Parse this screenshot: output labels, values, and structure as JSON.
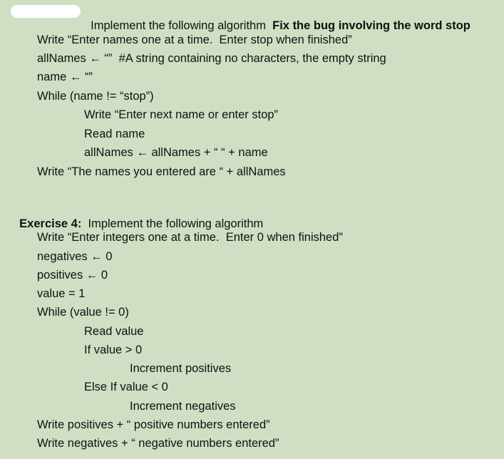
{
  "exercise3": {
    "heading_prefix": "Implement the following algorithm",
    "heading_bold": "Fix the bug involving the word stop",
    "lines": [
      "Write “Enter names one at a time.  Enter stop when finished”",
      "allNames ← “”  #A string containing no characters, the empty string",
      "name ← “”",
      "While (name != “stop”)",
      "Write “Enter next name or enter stop”",
      "Read name",
      "allNames ← allNames + “ “ + name",
      "Write “The names you entered are “ + allNames"
    ]
  },
  "exercise4": {
    "label": "Exercise 4:",
    "heading": "Implement the following algorithm",
    "lines": [
      "Write “Enter integers one at a time.  Enter 0 when finished”",
      "negatives ← 0",
      "positives ← 0",
      "value = 1",
      "While (value != 0)",
      "Read value",
      "If value > 0",
      "Increment positives",
      "Else If value < 0",
      "Increment negatives",
      "Write positives + “ positive numbers entered”",
      "Write negatives + “ negative numbers entered”"
    ]
  }
}
